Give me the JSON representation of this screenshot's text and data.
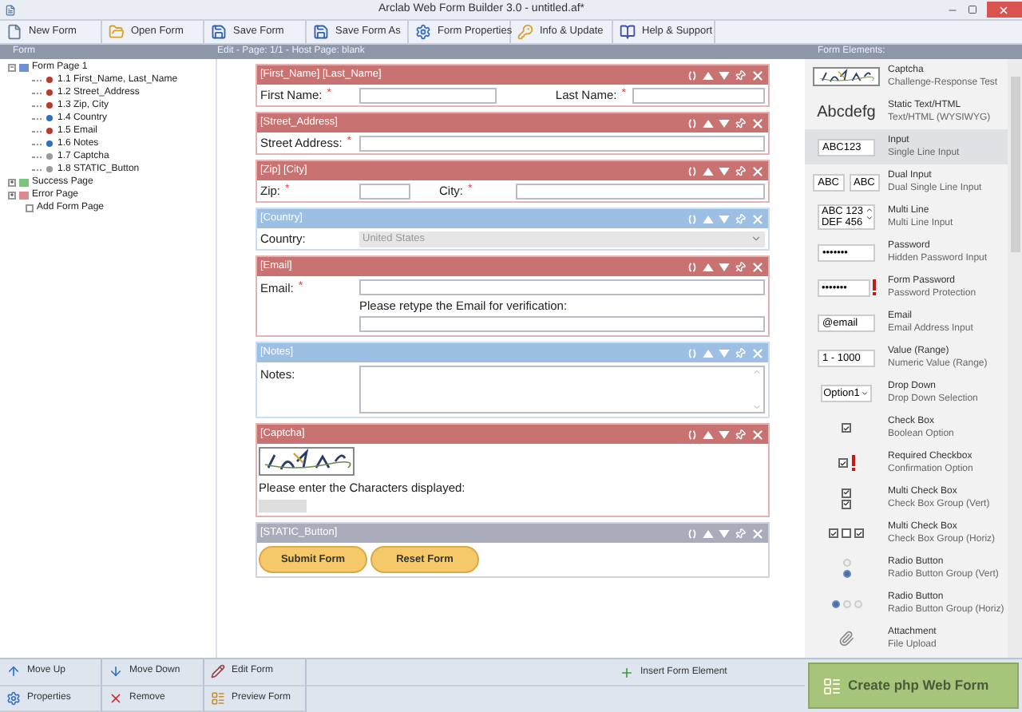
{
  "window": {
    "title": "Arclab Web Form Builder 3.0 - untitled.af*"
  },
  "toolbar": [
    {
      "label": "New Form"
    },
    {
      "label": "Open Form"
    },
    {
      "label": "Save Form"
    },
    {
      "label": "Save Form As"
    },
    {
      "label": "Form Properties"
    },
    {
      "label": "Info & Update"
    },
    {
      "label": "Help & Support"
    }
  ],
  "headers": {
    "form": "Form",
    "editor": "Edit - Page: 1/1 - Host Page: blank",
    "elements": "Form Elements:"
  },
  "tree": [
    {
      "kind": "page",
      "label": "Form Page 1",
      "expanded": true,
      "color": "#6f8fd0",
      "children": [
        {
          "label": "1.1 First_Name, Last_Name",
          "color": "#c0392b"
        },
        {
          "label": "1.2 Street_Address",
          "color": "#c0392b"
        },
        {
          "label": "1.3 Zip, City",
          "color": "#c0392b"
        },
        {
          "label": "1.4 Country",
          "color": "#2f6fc4"
        },
        {
          "label": "1.5 Email",
          "color": "#c0392b"
        },
        {
          "label": "1.6 Notes",
          "color": "#2f6fc4"
        },
        {
          "label": "1.7 Captcha",
          "color": "#9a9a9a"
        },
        {
          "label": "1.8 STATIC_Button",
          "color": "#9a9a9a"
        }
      ]
    },
    {
      "kind": "page",
      "label": "Success Page",
      "expanded": false,
      "color": "#7cc47c"
    },
    {
      "kind": "page",
      "label": "Error Page",
      "expanded": false,
      "color": "#d98a8a"
    },
    {
      "kind": "action",
      "label": "Add Form Page"
    }
  ],
  "blocks": [
    {
      "header": "[First_Name] [Last_Name]",
      "color": "#c87272",
      "kind": "dual",
      "fields": [
        {
          "label": "First Name:",
          "mark": "*"
        },
        {
          "label": "Last Name:",
          "mark": "*"
        }
      ]
    },
    {
      "header": "[Street_Address]",
      "color": "#c87272",
      "kind": "single",
      "fields": [
        {
          "label": "Street Address:",
          "mark": "*"
        }
      ]
    },
    {
      "header": "[Zip] [City]",
      "color": "#c87272",
      "kind": "zip",
      "fields": [
        {
          "label": "Zip:",
          "mark": "*"
        },
        {
          "label": "City:",
          "mark": "*"
        }
      ]
    },
    {
      "header": "[Country]",
      "color": "#9dbfe4",
      "kind": "select",
      "fields": [
        {
          "label": "Country:",
          "value": "United States"
        }
      ]
    },
    {
      "header": "[Email]",
      "color": "#c87272",
      "kind": "email",
      "fields": [
        {
          "label": "Email:",
          "mark": "*",
          "verify": "Please retype the Email for verification:"
        }
      ]
    },
    {
      "header": "[Notes]",
      "color": "#9dbfe4",
      "kind": "textarea",
      "fields": [
        {
          "label": "Notes:"
        }
      ]
    },
    {
      "header": "[Captcha]",
      "color": "#c87272",
      "kind": "captcha",
      "fields": [
        {
          "label": "Please enter the Characters displayed:"
        }
      ]
    },
    {
      "header": "[STATIC_Button]",
      "color": "#a9acba",
      "kind": "buttons",
      "buttons": [
        "Submit Form",
        "Reset Form"
      ]
    }
  ],
  "elements": [
    {
      "kind": "captcha",
      "title": "Captcha",
      "subtitle": "Challenge-Response Test",
      "selected": false
    },
    {
      "kind": "static",
      "title": "Static Text/HTML",
      "subtitle": "Text/HTML (WYSIWYG)",
      "preview": [
        "Abcdefg"
      ],
      "selected": false
    },
    {
      "kind": "input",
      "title": "Input",
      "subtitle": "Single Line Input",
      "preview": [
        "ABC123"
      ],
      "selected": true
    },
    {
      "kind": "dual",
      "title": "Dual Input",
      "subtitle": "Dual Single Line Input",
      "preview": [
        "ABC",
        "ABC"
      ],
      "selected": false
    },
    {
      "kind": "multiline",
      "title": "Multi Line",
      "subtitle": "Multi Line Input",
      "preview": [
        "ABC 123",
        "DEF 456"
      ],
      "selected": false
    },
    {
      "kind": "input",
      "title": "Password",
      "subtitle": "Hidden Password Input",
      "preview": [
        "•••••••"
      ],
      "selected": false
    },
    {
      "kind": "protected",
      "title": "Form Password",
      "subtitle": "Password Protection",
      "preview": [
        "•••••••"
      ],
      "selected": false
    },
    {
      "kind": "input",
      "title": "Email",
      "subtitle": "Email Address Input",
      "preview": [
        "@email"
      ],
      "selected": false
    },
    {
      "kind": "input",
      "title": "Value (Range)",
      "subtitle": "Numeric Value (Range)",
      "preview": [
        "1 - 1000"
      ],
      "selected": false
    },
    {
      "kind": "dropdown",
      "title": "Drop Down",
      "subtitle": "Drop Down Selection",
      "preview": [
        "Option1"
      ],
      "selected": false
    },
    {
      "kind": "checkbox",
      "title": "Check Box",
      "subtitle": "Boolean Option",
      "selected": false
    },
    {
      "kind": "required_checkbox",
      "title": "Required Checkbox",
      "subtitle": "Confirmation Option",
      "selected": false
    },
    {
      "kind": "checkbox_vert",
      "title": "Multi Check Box",
      "subtitle": "Check Box Group (Vert)",
      "selected": false
    },
    {
      "kind": "checkbox_horiz",
      "title": "Multi Check Box",
      "subtitle": "Check Box Group (Horiz)",
      "selected": false
    },
    {
      "kind": "radio_vert",
      "title": "Radio Button",
      "subtitle": "Radio Button Group (Vert)",
      "selected": false
    },
    {
      "kind": "radio_horiz",
      "title": "Radio Button",
      "subtitle": "Radio Button Group (Horiz)",
      "selected": false
    },
    {
      "kind": "attachment",
      "title": "Attachment",
      "subtitle": "File Upload",
      "selected": false
    }
  ],
  "bottom": [
    {
      "label": "Move Up"
    },
    {
      "label": "Move Down"
    },
    {
      "label": "Edit Form"
    },
    {
      "label": "Insert Form Element"
    },
    {
      "label": "Properties"
    },
    {
      "label": "Remove"
    },
    {
      "label": "Preview Form"
    }
  ],
  "create_button": {
    "label": "Create php Web Form"
  }
}
